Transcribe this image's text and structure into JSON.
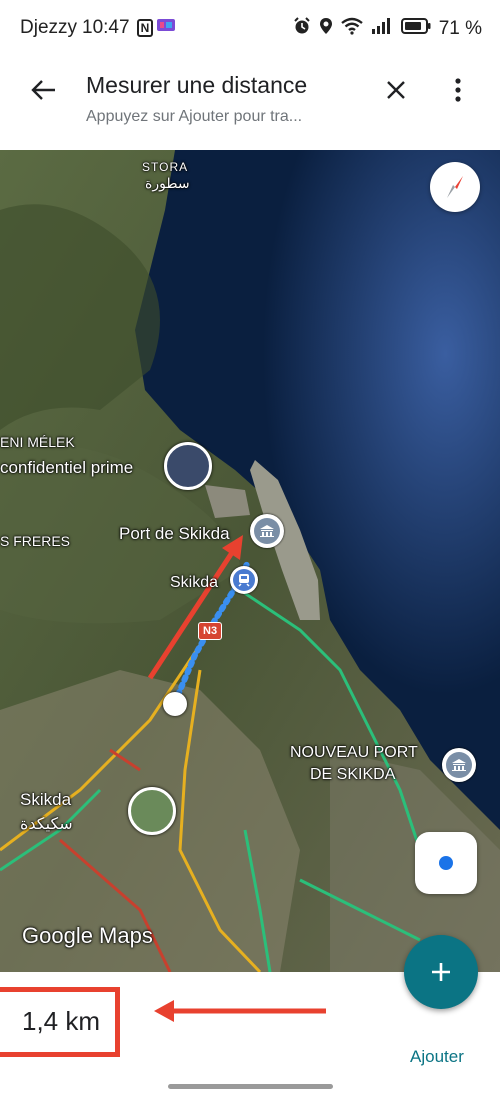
{
  "status_bar": {
    "carrier": "Djezzy",
    "time": "10:47",
    "nfc_label": "N",
    "battery_pct": "71 %"
  },
  "app_bar": {
    "title": "Mesurer une distance",
    "subtitle": "Appuyez sur Ajouter pour tra..."
  },
  "map": {
    "labels": {
      "stora": "STORA",
      "stora_ar": "سطورة",
      "beni_melek": "ENI MÉLEK",
      "confidentiel": "confidentiel prime",
      "freres": "S FRERES",
      "port": "Port de Skikda",
      "skikda_station": "Skikda",
      "route": "N3",
      "nouveau_port_1": "NOUVEAU PORT",
      "nouveau_port_2": "DE SKIKDA",
      "skikda_city": "Skikda",
      "skikda_city_ar": "سكيكدة",
      "watermark": "Google Maps"
    },
    "colors": {
      "sea": "#0a1f3f",
      "land": "#4a5a3a",
      "accent": "#0b7484",
      "annotation": "#e8412f"
    }
  },
  "result": {
    "distance": "1,4 km",
    "add_label": "Ajouter"
  }
}
